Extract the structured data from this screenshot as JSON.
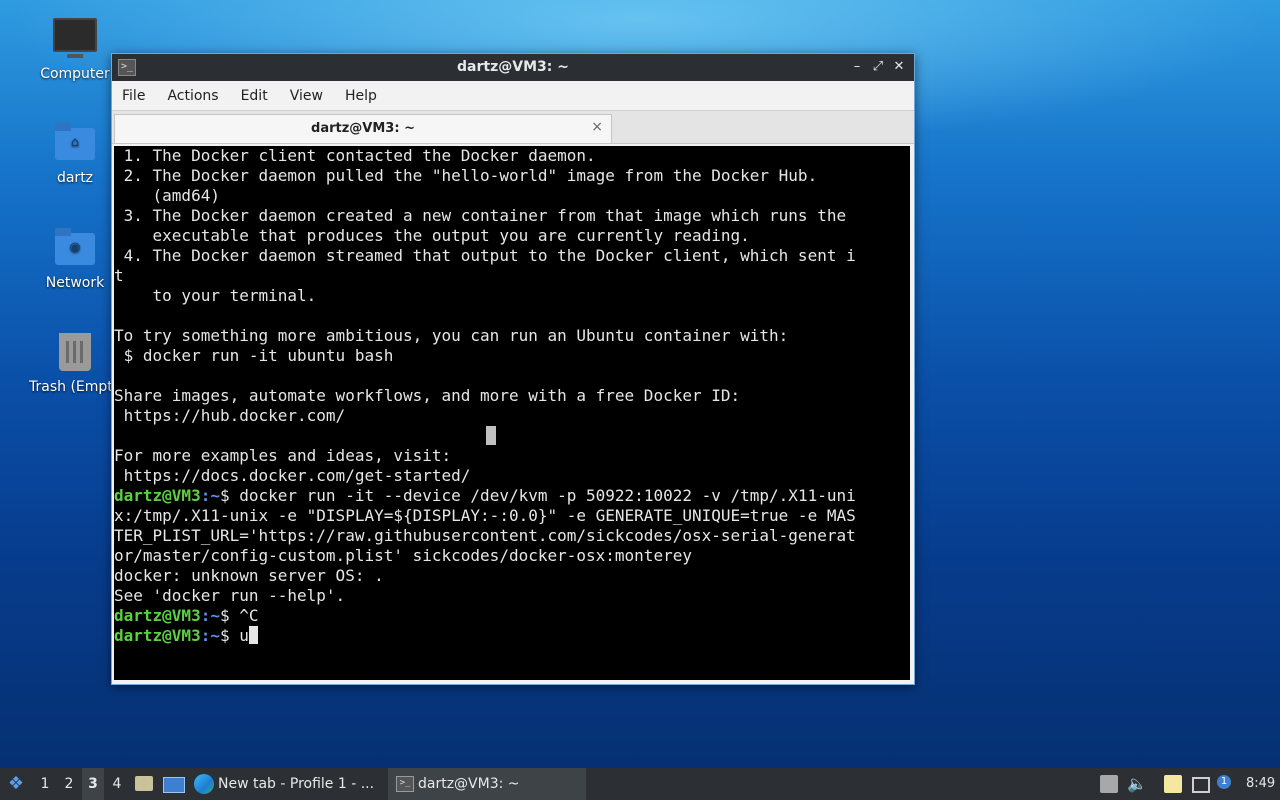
{
  "desktop": {
    "icons": [
      {
        "label": "Computer"
      },
      {
        "label": "dartz"
      },
      {
        "label": "Network"
      },
      {
        "label": "Trash (Empty)"
      }
    ]
  },
  "window": {
    "title": "dartz@VM3: ~",
    "menu": [
      "File",
      "Actions",
      "Edit",
      "View",
      "Help"
    ],
    "tab_label": "dartz@VM3: ~",
    "close_symbol": "×"
  },
  "terminal": {
    "output": " 1. The Docker client contacted the Docker daemon.\n 2. The Docker daemon pulled the \"hello-world\" image from the Docker Hub.\n    (amd64)\n 3. The Docker daemon created a new container from that image which runs the\n    executable that produces the output you are currently reading.\n 4. The Docker daemon streamed that output to the Docker client, which sent i\nt\n    to your terminal.\n\nTo try something more ambitious, you can run an Ubuntu container with:\n $ docker run -it ubuntu bash\n\nShare images, automate workflows, and more with a free Docker ID:\n https://hub.docker.com/\n\nFor more examples and ideas, visit:\n https://docs.docker.com/get-started/\n",
    "prompt_user": "dartz@VM3",
    "prompt_path": ":~",
    "prompt_symbol": "$ ",
    "command1": "docker run -it --device /dev/kvm -p 50922:10022 -v /tmp/.X11-uni\nx:/tmp/.X11-unix -e \"DISPLAY=${DISPLAY:-:0.0}\" -e GENERATE_UNIQUE=true -e MAS\nTER_PLIST_URL='https://raw.githubusercontent.com/sickcodes/osx-serial-generat\nor/master/config-custom.plist' sickcodes/docker-osx:monterey",
    "error_output": "docker: unknown server OS: .\nSee 'docker run --help'.",
    "command2": "^C",
    "current_input": "u"
  },
  "taskbar": {
    "workspaces": [
      "1",
      "2",
      "3",
      "4"
    ],
    "active_workspace": "3",
    "tasks": [
      {
        "label": "New tab - Profile 1 - ..."
      },
      {
        "label": "dartz@VM3: ~"
      }
    ],
    "clock": "8:49",
    "notification_count": "1"
  },
  "colors": {
    "prompt_user": "#5bd140",
    "prompt_path": "#5c8ee6",
    "terminal_bg": "#000000",
    "titlebar_bg": "#2b2f33",
    "taskbar_bg": "#2c2f33"
  }
}
